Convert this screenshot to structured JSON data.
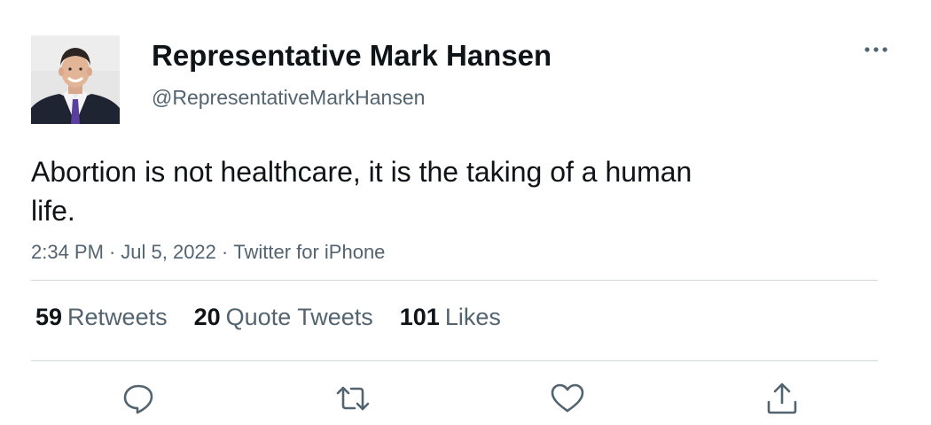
{
  "author": {
    "display_name": "Representative Mark Hansen",
    "handle": "@RepresentativeMarkHansen",
    "avatar_icon": "profile-photo"
  },
  "tweet": {
    "text": "Abortion is not healthcare, it is the taking of a human life.",
    "time": "2:34 PM",
    "date": "Jul 5, 2022",
    "source": "Twitter for iPhone",
    "separator": "·"
  },
  "stats": {
    "retweets_count": "59",
    "retweets_label": "Retweets",
    "quote_tweets_count": "20",
    "quote_tweets_label": "Quote Tweets",
    "likes_count": "101",
    "likes_label": "Likes"
  },
  "actions": {
    "reply_icon": "reply-icon",
    "retweet_icon": "retweet-icon",
    "like_icon": "heart-icon",
    "share_icon": "share-icon"
  },
  "colors": {
    "primary_text": "#0f1419",
    "secondary_text": "#536471",
    "divider": "#cfd9de"
  }
}
